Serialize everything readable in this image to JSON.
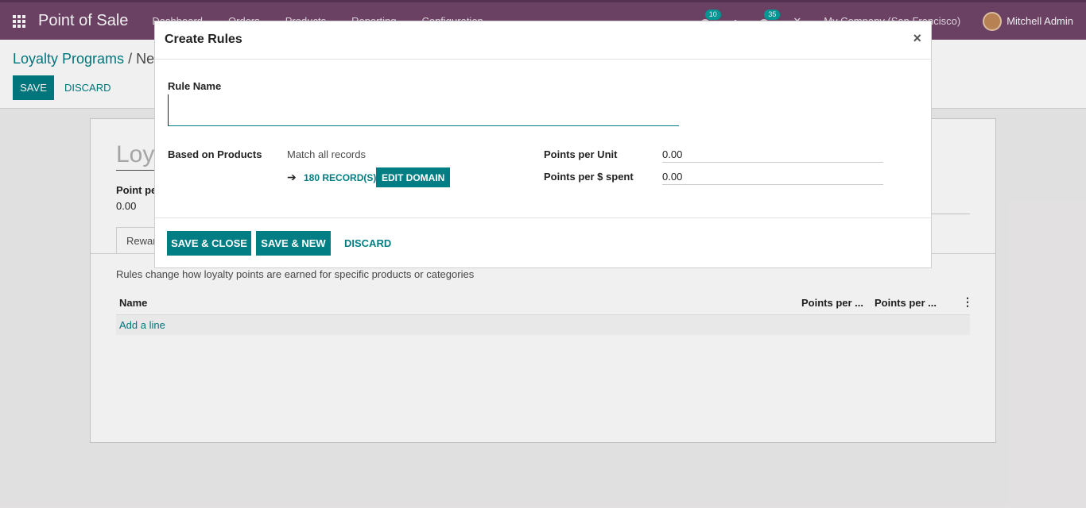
{
  "navbar": {
    "brand": "Point of Sale",
    "menu": [
      "Dashboard",
      "Orders",
      "Products",
      "Reporting",
      "Configuration"
    ],
    "messages_count": "10",
    "activities_count": "35",
    "company": "My Company (San Francisco)",
    "user": "Mitchell Admin"
  },
  "control": {
    "breadcrumb_parent": "Loyalty Programs",
    "breadcrumb_sep": " / ",
    "breadcrumb_current": "Ne",
    "save_label": "SAVE",
    "discard_label": "DISCARD"
  },
  "sheet": {
    "title_fragment": "Loy",
    "points_label_fragment": "Point pe",
    "points_value": "0.00",
    "tab_fragment": "Rewar",
    "description": "Rules change how loyalty points are earned for specific products or categories",
    "columns": [
      "Name",
      "Points per ...",
      "Points per ..."
    ],
    "add_line": "Add a line"
  },
  "modal": {
    "title": "Create Rules",
    "close_glyph": "×",
    "rule_name_label": "Rule Name",
    "rule_name_value": "",
    "based_on_label": "Based on Products",
    "match_prefix": "Match ",
    "match_emph": "all records",
    "records_label": "180 RECORD(S)",
    "edit_domain_label": "EDIT DOMAIN",
    "points_per_unit_label": "Points per Unit",
    "points_per_unit_value": "0.00",
    "points_per_spent_label": "Points per $ spent",
    "points_per_spent_value": "0.00",
    "save_close_label": "SAVE & CLOSE",
    "save_new_label": "SAVE & NEW",
    "discard_label": "DISCARD"
  },
  "colors": {
    "navbar": "#71456a",
    "primary": "#017e84",
    "badge": "#00a09d"
  }
}
